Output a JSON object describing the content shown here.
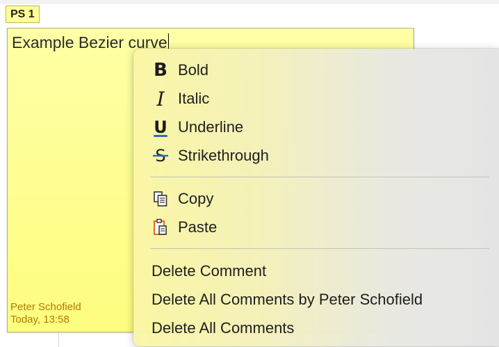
{
  "author_tag": {
    "initials": "PS 1"
  },
  "comment": {
    "text": "Example Bezier curve",
    "author": "Peter Schofield",
    "date": "Today, 13:58",
    "colors": {
      "background": "#ffffa6",
      "meta_text": "#b07a00"
    }
  },
  "context_menu": {
    "format_items": [
      {
        "label": "Bold",
        "icon": "bold-icon",
        "glyph": "B"
      },
      {
        "label": "Italic",
        "icon": "italic-icon",
        "glyph": "I"
      },
      {
        "label": "Underline",
        "icon": "underline-icon",
        "glyph": "U"
      },
      {
        "label": "Strikethrough",
        "icon": "strikethrough-icon",
        "glyph": "S"
      }
    ],
    "clipboard_items": [
      {
        "label": "Copy",
        "icon": "copy-icon"
      },
      {
        "label": "Paste",
        "icon": "paste-icon"
      }
    ],
    "delete_items": [
      {
        "label": "Delete Comment"
      },
      {
        "label": "Delete All Comments by Peter Schofield"
      },
      {
        "label": "Delete All Comments"
      }
    ]
  }
}
